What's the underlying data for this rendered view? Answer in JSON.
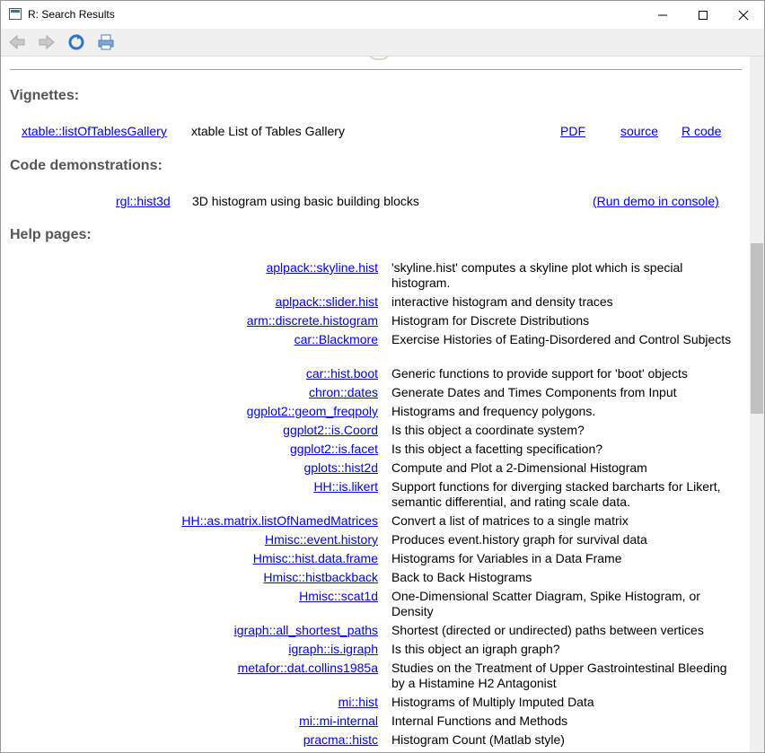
{
  "window": {
    "title": "R: Search Results",
    "minimize": "—",
    "maximize": "☐",
    "close": "✕"
  },
  "toolbar": {
    "back": "back",
    "forward": "forward",
    "refresh": "refresh",
    "print": "print"
  },
  "sections": {
    "vignettes": "Vignettes:",
    "demos": "Code demonstrations:",
    "help": "Help pages:"
  },
  "vignettes": [
    {
      "name": "xtable::listOfTablesGallery",
      "desc": "xtable List of Tables Gallery",
      "pdf": "PDF",
      "source": "source",
      "rcode": "R code"
    }
  ],
  "demos": [
    {
      "name": "rgl::hist3d",
      "desc": "3D histogram using basic building blocks",
      "run": "(Run demo in console)"
    }
  ],
  "help": [
    {
      "name": "aplpack::skyline.hist",
      "desc": "'skyline.hist' computes a skyline plot which is special histogram."
    },
    {
      "name": "aplpack::slider.hist",
      "desc": "interactive histogram and density traces"
    },
    {
      "name": "arm::discrete.histogram",
      "desc": "Histogram for Discrete Distributions"
    },
    {
      "name": "car::Blackmore",
      "desc": "Exercise Histories of Eating-Disordered and Control Subjects"
    },
    {
      "name": "car::hist.boot",
      "desc": "Generic functions to provide support for 'boot' objects"
    },
    {
      "name": "chron::dates",
      "desc": "Generate Dates and Times Components from Input"
    },
    {
      "name": "ggplot2::geom_freqpoly",
      "desc": "Histograms and frequency polygons."
    },
    {
      "name": "ggplot2::is.Coord",
      "desc": "Is this object a coordinate system?"
    },
    {
      "name": "ggplot2::is.facet",
      "desc": "Is this object a facetting specification?"
    },
    {
      "name": "gplots::hist2d",
      "desc": "Compute and Plot a 2-Dimensional Histogram"
    },
    {
      "name": "HH::is.likert",
      "desc": "Support functions for diverging stacked barcharts for Likert, semantic differential, and rating scale data."
    },
    {
      "name": "HH::as.matrix.listOfNamedMatrices",
      "desc": "Convert a list of matrices to a single matrix"
    },
    {
      "name": "Hmisc::event.history",
      "desc": "Produces event.history graph for survival data"
    },
    {
      "name": "Hmisc::hist.data.frame",
      "desc": "Histograms for Variables in a Data Frame"
    },
    {
      "name": "Hmisc::histbackback",
      "desc": "Back to Back Histograms"
    },
    {
      "name": "Hmisc::scat1d",
      "desc": "One-Dimensional Scatter Diagram, Spike Histogram, or Density"
    },
    {
      "name": "igraph::all_shortest_paths",
      "desc": "Shortest (directed or undirected) paths between vertices"
    },
    {
      "name": "igraph::is.igraph",
      "desc": "Is this object an igraph graph?"
    },
    {
      "name": "metafor::dat.collins1985a",
      "desc": "Studies on the Treatment of Upper Gastrointestinal Bleeding by a Histamine H2 Antagonist"
    },
    {
      "name": "mi::hist",
      "desc": "Histograms of Multiply Imputed Data"
    },
    {
      "name": "mi::mi-internal",
      "desc": "Internal Functions and Methods"
    },
    {
      "name": "pracma::histc",
      "desc": "Histogram Count (Matlab style)"
    }
  ]
}
